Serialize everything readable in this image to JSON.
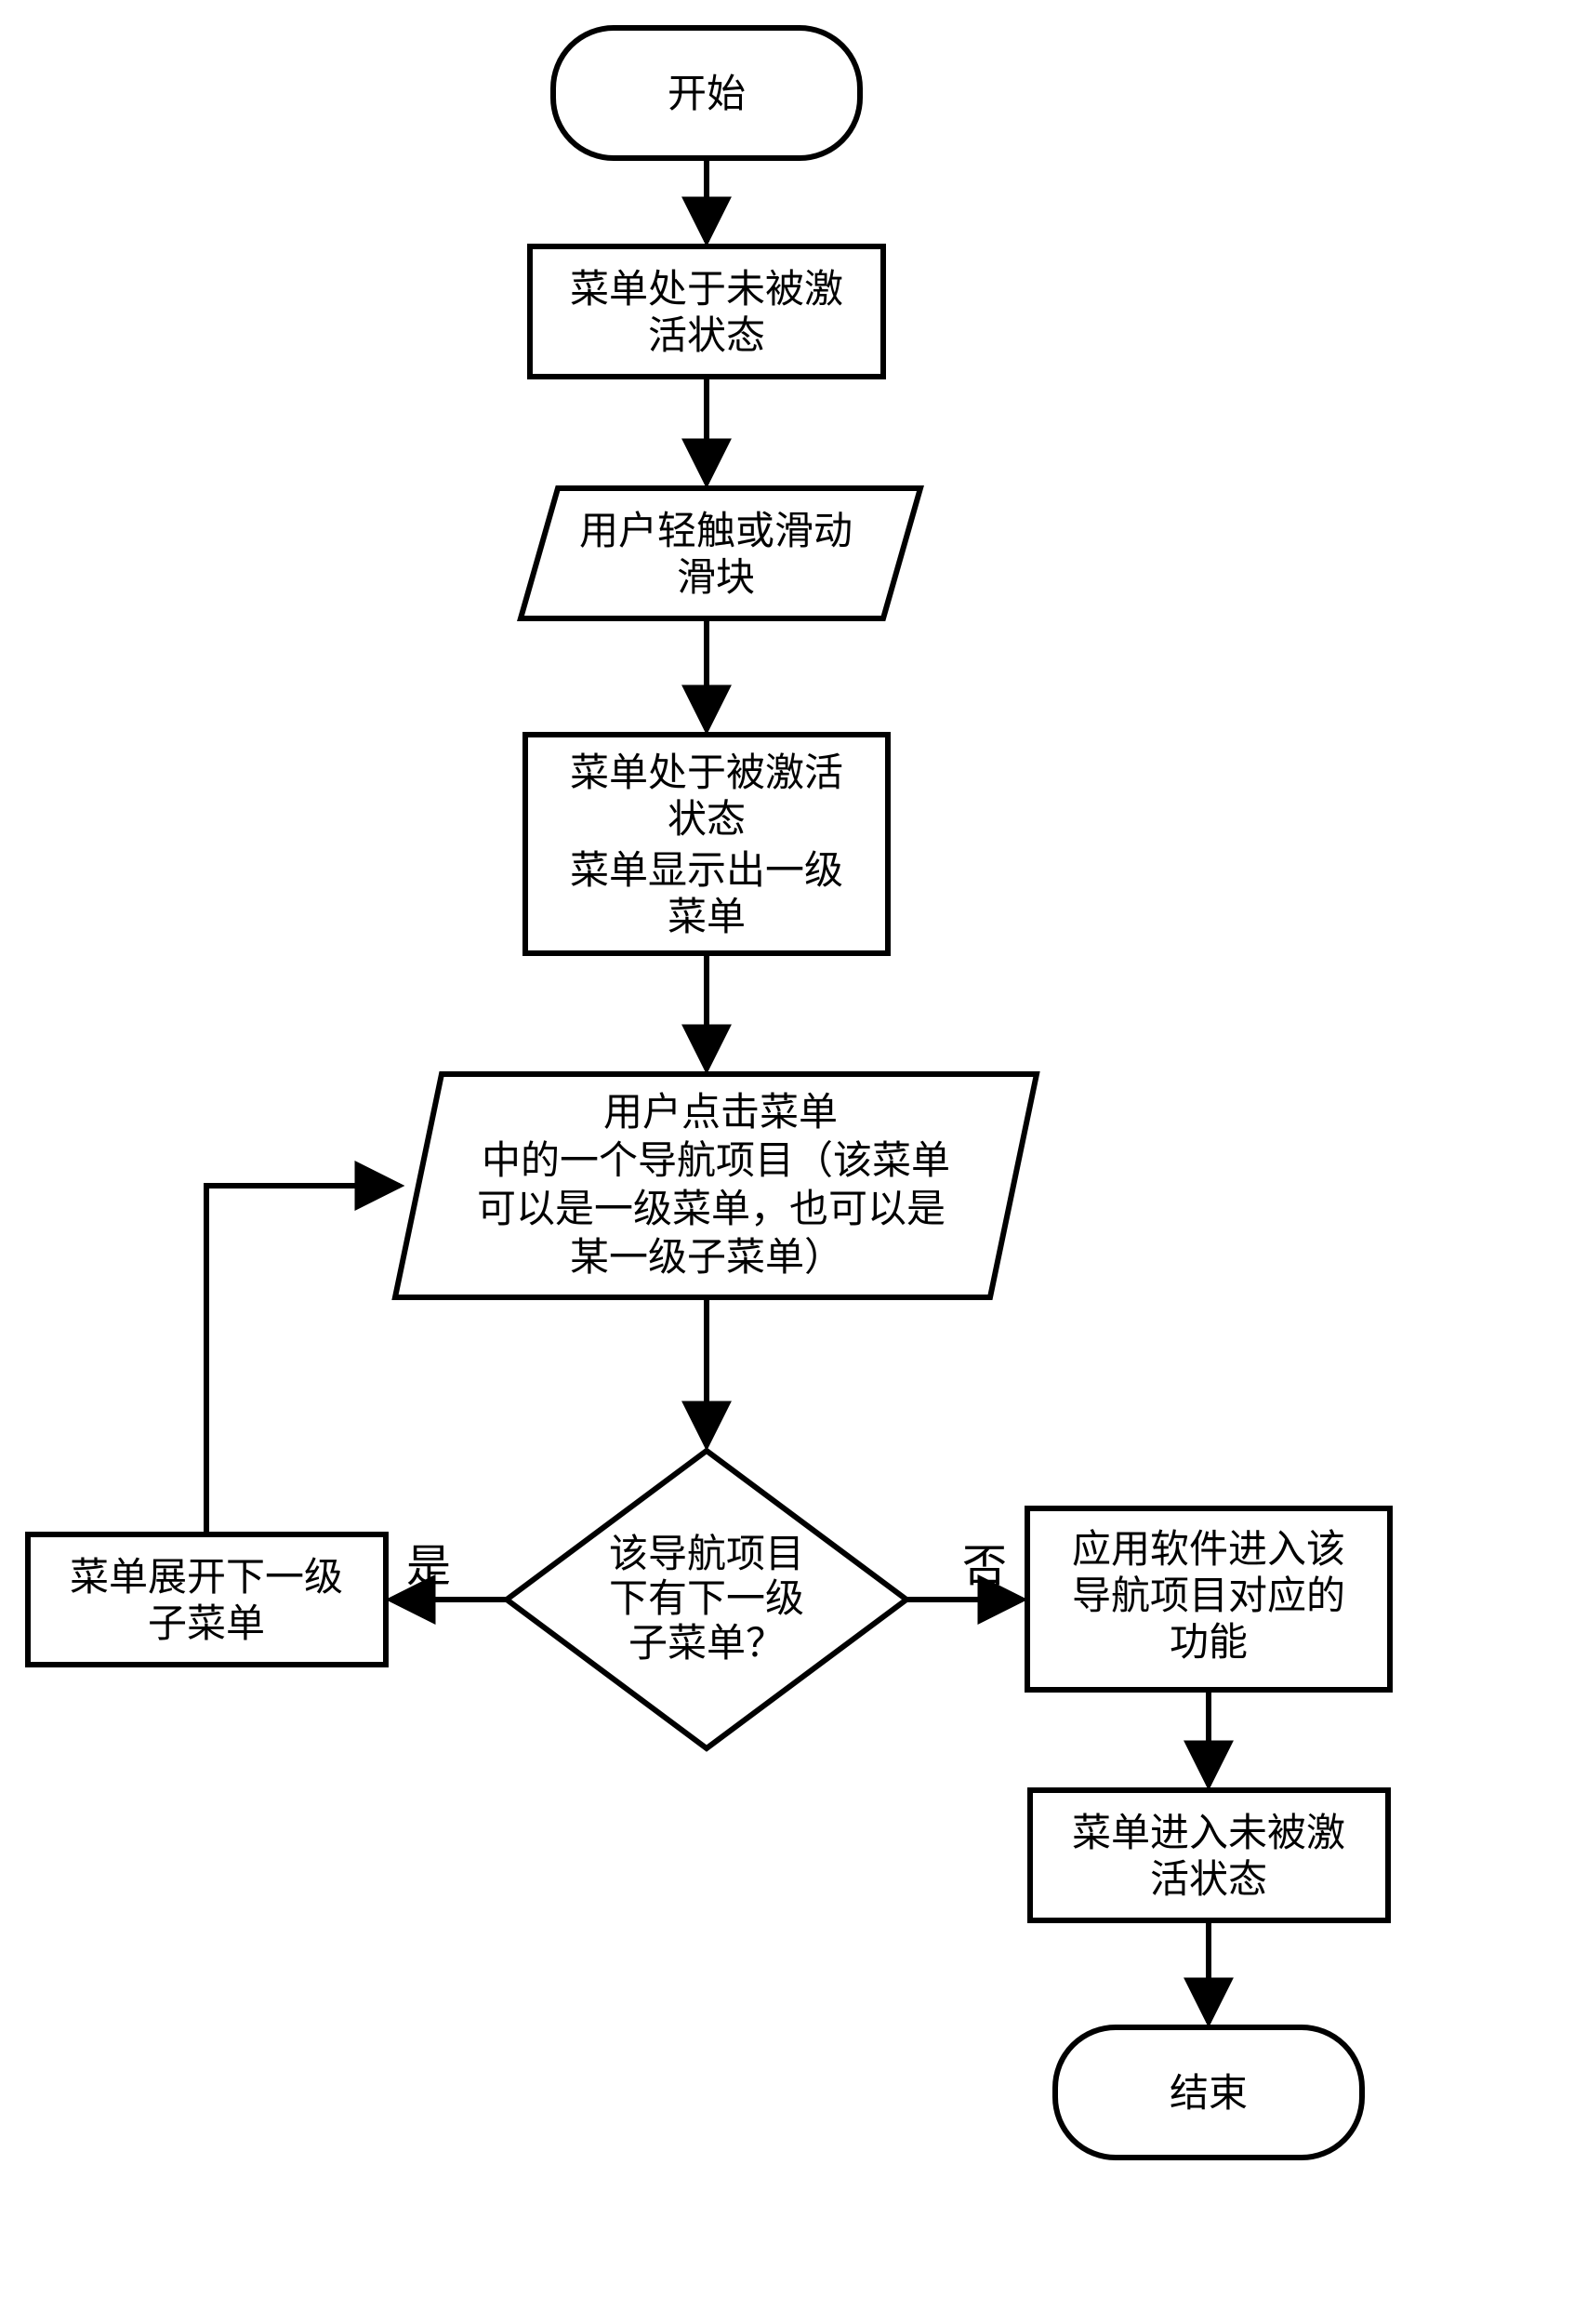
{
  "chart_data": {
    "type": "flowchart",
    "nodes": [
      {
        "id": "start",
        "shape": "terminator",
        "text": "开始"
      },
      {
        "id": "n1",
        "shape": "process",
        "text": "菜单处于未被激\n活状态"
      },
      {
        "id": "n2",
        "shape": "io",
        "text": "用户轻触或滑动\n滑块"
      },
      {
        "id": "n3",
        "shape": "process",
        "text": "菜单处于被激活\n状态\n菜单显示出一级\n菜单"
      },
      {
        "id": "n4",
        "shape": "io",
        "text": "用户点击菜单\n中的一个导航项目（该菜单\n可以是一级菜单，也可以是\n某一级子菜单）"
      },
      {
        "id": "d1",
        "shape": "decision",
        "text": "该导航项目\n下有下一级\n子菜单？"
      },
      {
        "id": "n5",
        "shape": "process",
        "text": "菜单展开下一级\n子菜单"
      },
      {
        "id": "n6",
        "shape": "process",
        "text": "应用软件进入该\n导航项目对应的\n功能"
      },
      {
        "id": "n7",
        "shape": "process",
        "text": "菜单进入未被激\n活状态"
      },
      {
        "id": "end",
        "shape": "terminator",
        "text": "结束"
      }
    ],
    "edges": [
      {
        "from": "start",
        "to": "n1"
      },
      {
        "from": "n1",
        "to": "n2"
      },
      {
        "from": "n2",
        "to": "n3"
      },
      {
        "from": "n3",
        "to": "n4"
      },
      {
        "from": "n4",
        "to": "d1"
      },
      {
        "from": "d1",
        "to": "n5",
        "label": "是"
      },
      {
        "from": "d1",
        "to": "n6",
        "label": "否"
      },
      {
        "from": "n5",
        "to": "n4"
      },
      {
        "from": "n6",
        "to": "n7"
      },
      {
        "from": "n7",
        "to": "end"
      }
    ]
  },
  "labels": {
    "yes": "是",
    "no": "否"
  },
  "texts": {
    "start": "开始",
    "n1l1": "菜单处于未被激",
    "n1l2": "活状态",
    "n2l1": "用户轻触或滑动",
    "n2l2": "滑块",
    "n3l1": "菜单处于被激活",
    "n3l2": "状态",
    "n3l3": "菜单显示出一级",
    "n3l4": "菜单",
    "n4l1": "用户点击菜单",
    "n4l2": "中的一个导航项目（该菜单",
    "n4l3": "可以是一级菜单，也可以是",
    "n4l4": "某一级子菜单）",
    "d1l1": "该导航项目",
    "d1l2": "下有下一级",
    "d1l3": "子菜单？",
    "n5l1": "菜单展开下一级",
    "n5l2": "子菜单",
    "n6l1": "应用软件进入该",
    "n6l2": "导航项目对应的",
    "n6l3": "功能",
    "n7l1": "菜单进入未被激",
    "n7l2": "活状态",
    "end": "结束"
  }
}
